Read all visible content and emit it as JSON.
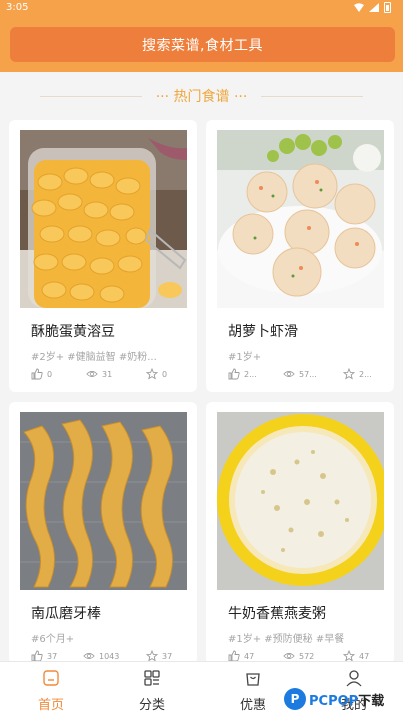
{
  "status": {
    "time": "3:05"
  },
  "search": {
    "label": "搜索菜谱,食材工具"
  },
  "section": {
    "title": "··· 热门食谱 ···"
  },
  "recipes": [
    {
      "title": "酥脆蛋黄溶豆",
      "tags": "#2岁+  #健脑益智  #奶粉...",
      "likes": "0",
      "views": "31",
      "favs": "0",
      "image": "yogurt-melts-in-jar"
    },
    {
      "title": "胡萝卜虾滑",
      "tags": "#1岁+",
      "likes": "2...",
      "views": "57...",
      "favs": "2...",
      "image": "shrimp-balls-in-bowl"
    },
    {
      "title": "南瓜磨牙棒",
      "tags": "#6个月+",
      "likes": "37",
      "views": "1043",
      "favs": "37",
      "image": "pumpkin-teething-sticks"
    },
    {
      "title": "牛奶香蕉燕麦粥",
      "tags": "#1岁+  #预防便秘  #早餐",
      "likes": "47",
      "views": "572",
      "favs": "47",
      "image": "milk-banana-oatmeal"
    }
  ],
  "tabs": [
    {
      "label": "首页",
      "icon": "home-icon",
      "active": true
    },
    {
      "label": "分类",
      "icon": "category-icon",
      "active": false
    },
    {
      "label": "优惠",
      "icon": "bag-icon",
      "active": false
    },
    {
      "label": "我的",
      "icon": "user-icon",
      "active": false
    }
  ],
  "watermark": {
    "logo": "P",
    "text": "PCPOP",
    "suffix": "下载"
  },
  "colors": {
    "header": "#f6a24b",
    "search": "#ee7e3b",
    "accent": "#ef8a3a",
    "section_title": "#f0a63b"
  }
}
